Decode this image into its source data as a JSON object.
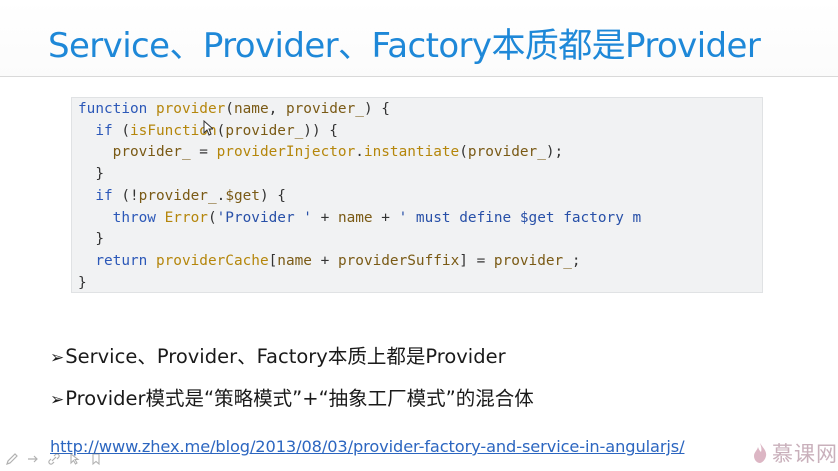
{
  "slide": {
    "title": "Service、Provider、Factory本质都是Provider"
  },
  "code": {
    "lines": [
      [
        [
          "kw",
          "function "
        ],
        [
          "fn",
          "provider"
        ],
        [
          "pun",
          "("
        ],
        [
          "id",
          "name"
        ],
        [
          "pun",
          ", "
        ],
        [
          "id",
          "provider_"
        ],
        [
          "pun",
          ") {"
        ]
      ],
      [
        [
          "pun",
          "  "
        ],
        [
          "kw",
          "if "
        ],
        [
          "pun",
          "("
        ],
        [
          "fn",
          "isFunction"
        ],
        [
          "pun",
          "("
        ],
        [
          "id",
          "provider_"
        ],
        [
          "pun",
          ")) {"
        ]
      ],
      [
        [
          "pun",
          "    "
        ],
        [
          "id",
          "provider_ "
        ],
        [
          "pun",
          "= "
        ],
        [
          "fn",
          "providerInjector"
        ],
        [
          "pun",
          "."
        ],
        [
          "fn",
          "instantiate"
        ],
        [
          "pun",
          "("
        ],
        [
          "id",
          "provider_"
        ],
        [
          "pun",
          ");"
        ]
      ],
      [
        [
          "pun",
          "  }"
        ]
      ],
      [
        [
          "pun",
          "  "
        ],
        [
          "kw",
          "if "
        ],
        [
          "pun",
          "(!"
        ],
        [
          "id",
          "provider_"
        ],
        [
          "pun",
          "."
        ],
        [
          "id",
          "$get"
        ],
        [
          "pun",
          ") {"
        ]
      ],
      [
        [
          "pun",
          "    "
        ],
        [
          "kw",
          "throw "
        ],
        [
          "fn",
          "Error"
        ],
        [
          "pun",
          "("
        ],
        [
          "str",
          "'Provider ' "
        ],
        [
          "pun",
          "+ "
        ],
        [
          "id",
          "name "
        ],
        [
          "pun",
          "+ "
        ],
        [
          "str",
          "' must define $get factory m"
        ]
      ],
      [
        [
          "pun",
          "  }"
        ]
      ],
      [
        [
          "pun",
          "  "
        ],
        [
          "kw",
          "return "
        ],
        [
          "fn",
          "providerCache"
        ],
        [
          "pun",
          "["
        ],
        [
          "id",
          "name "
        ],
        [
          "pun",
          "+ "
        ],
        [
          "id",
          "providerSuffix"
        ],
        [
          "pun",
          "] = "
        ],
        [
          "id",
          "provider_"
        ],
        [
          "pun",
          ";"
        ]
      ],
      [
        [
          "pun",
          "}"
        ]
      ]
    ]
  },
  "bullets": [
    {
      "marker": "➢",
      "text": "Service、Provider、Factory本质上都是Provider"
    },
    {
      "marker": "➢",
      "text": "Provider模式是“策略模式”+“抽象工厂模式”的混合体"
    }
  ],
  "link": {
    "text": "http://www.zhex.me/blog/2013/08/03/provider-factory-and-service-in-angularjs/"
  },
  "toolbar": {
    "icons": [
      "pen-icon",
      "arrow-icon",
      "link-icon",
      "pointer-icon",
      "bookmark-icon"
    ]
  },
  "watermark": {
    "text": "慕课网"
  },
  "colors": {
    "title": "#1e88d8",
    "link": "#2c66c0",
    "code_background": "#f1f2f3",
    "watermark": "#c9b0bb"
  }
}
